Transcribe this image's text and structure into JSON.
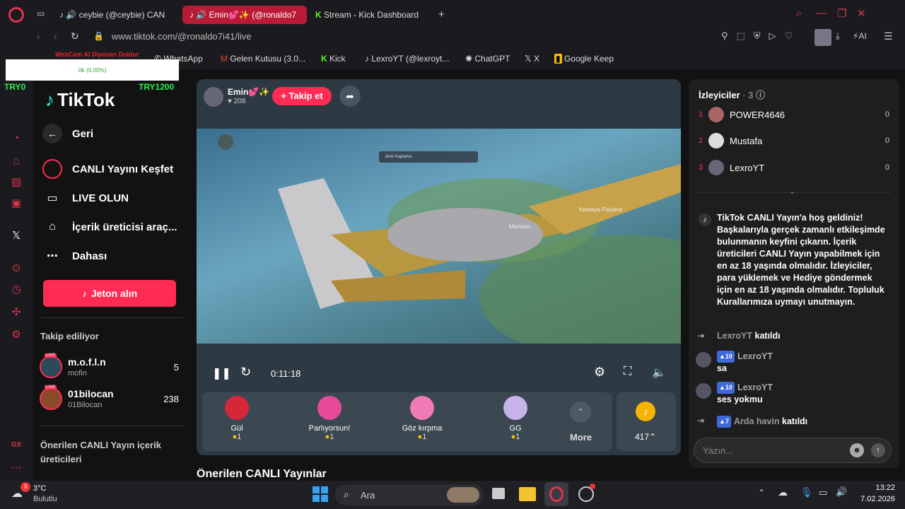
{
  "browser": {
    "tabs": [
      {
        "label": "ceybie (@ceybie) CAN",
        "sound": "🔊"
      },
      {
        "label": "Emin💕✨ (@ronaldo7",
        "sound": "🔊"
      },
      {
        "label": "Stream - Kick Dashboard"
      }
    ],
    "url": "www.tiktok.com/@ronaldo7i41/live",
    "ai_label": "AI",
    "bookmarks": [
      "WhatsApp",
      "Gelen Kutusu (3.0...",
      "Kick",
      "LexroYT (@lexroyt...",
      "ChatGPT",
      "X",
      "Google Keep"
    ]
  },
  "overlay": {
    "title": "WebCam Al Diyosan Doldur",
    "progress_text": "0₺ (0.00%)",
    "left_label": "TRY0",
    "right_label": "TRY1200",
    "progress": 0
  },
  "tiktok": {
    "logo": "TikTok",
    "back": "Geri",
    "nav": [
      "CANLI Yayını Keşfet",
      "LIVE OLUN",
      "İçerik üreticisi araç...",
      "Dahası"
    ],
    "coins_button": "Jeton alın",
    "following_title": "Takip ediliyor",
    "following": [
      {
        "name": "m.o.f.l.n",
        "handle": "mofin",
        "count": "5",
        "badge": "LIVE"
      },
      {
        "name": "01bilocan",
        "handle": "01Bilocan",
        "count": "238",
        "badge": "LIVE"
      }
    ],
    "suggested_title": "Önerilen CANLI Yayın içerik üreticileri",
    "suggested_live": "Önerilen CANLI Yayınlar"
  },
  "player": {
    "host": "Emin💕✨",
    "likes": "208",
    "follow": "+ Takip et",
    "time": "0:11:18",
    "game_labels": [
      "Jenti Kaplama",
      "Yasnaya Polyana",
      "Mansion"
    ],
    "gifts": [
      {
        "name": "Gül",
        "price": "1"
      },
      {
        "name": "Parlıyorsun!",
        "price": "1"
      },
      {
        "name": "Göz kırpma",
        "price": "1"
      },
      {
        "name": "GG",
        "price": "1"
      }
    ],
    "more": "More",
    "coins": "417"
  },
  "viewers": {
    "title": "İzleyiciler",
    "count": "· 3",
    "list": [
      {
        "rank": "1",
        "name": "POWER4646",
        "score": "0"
      },
      {
        "rank": "2",
        "name": "Mustafa",
        "score": "0"
      },
      {
        "rank": "3",
        "name": "LexroYT",
        "score": "0"
      }
    ]
  },
  "chat": {
    "welcome": "TikTok CANLI Yayın'a hoş geldiniz! Başkalarıyla gerçek zamanlı etkileşimde bulunmanın keyfini çıkarın. İçerik üreticileri CANLI Yayın yapabilmek için en az 18 yaşında olmalıdır. İzleyiciler, para yüklemek ve Hediye göndermek için en az 18 yaşında olmalıdır. Topluluk Kurallarımıza uymayı unutmayın.",
    "join1": {
      "user": "LexroYT",
      "text": "katıldı"
    },
    "msg1": {
      "level": "10",
      "user": "LexroYT",
      "text": "sa"
    },
    "msg2": {
      "level": "10",
      "user": "LexroYT",
      "text": "ses yokmu"
    },
    "join2": {
      "level": "7",
      "user": "Arda havin",
      "text": "katıldı"
    },
    "placeholder": "Yazın..."
  },
  "taskbar": {
    "weather_temp": "3°C",
    "weather_desc": "Bulutlu",
    "weather_badge": "3",
    "search": "Ara",
    "time": "13:22",
    "date": "7.02.2026"
  }
}
